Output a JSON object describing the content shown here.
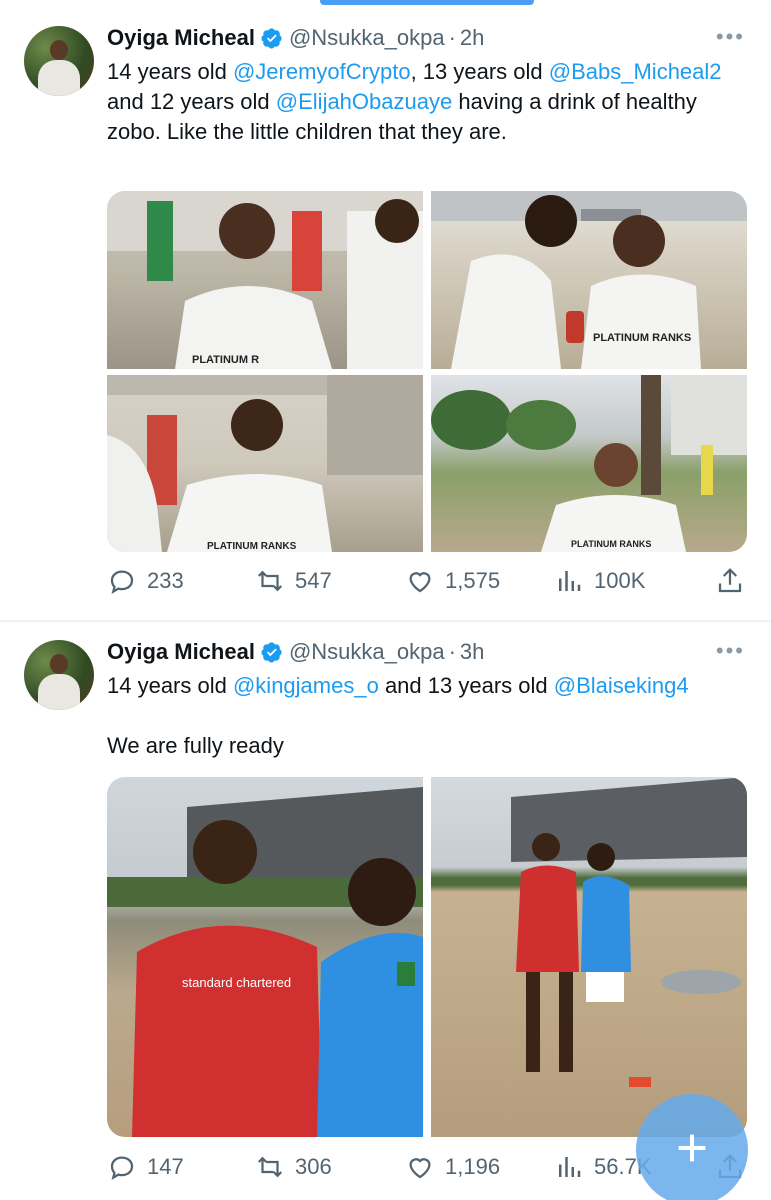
{
  "tweets": [
    {
      "author": "Oyiga Micheal",
      "handle": "@Nsukka_okpa",
      "sep": "·",
      "time": "2h",
      "text_parts": [
        "14 years old ",
        "@JeremyofCrypto",
        ", 13 years old ",
        "@Babs_Micheal2",
        " and 12 years old ",
        "@ElijahObazuaye",
        " having a drink of healthy zobo. Like the little children that they are."
      ],
      "photo_jersey_text": [
        "PLATINUM R",
        "PLATINUM RANKS",
        "PLATINUM RANKS",
        "PLATINUM RANKS"
      ],
      "stats": {
        "replies": "233",
        "retweets": "547",
        "likes": "1,575",
        "views": "100K"
      }
    },
    {
      "author": "Oyiga Micheal",
      "handle": "@Nsukka_okpa",
      "sep": "·",
      "time": "3h",
      "text_parts": [
        "14 years old ",
        "@kingjames_o",
        " and 13 years old ",
        "@Blaiseking4"
      ],
      "text_line2": "We are fully ready",
      "photo_jersey_text": [
        "standard chartered"
      ],
      "stats": {
        "replies": "147",
        "retweets": "306",
        "likes": "1,196",
        "views": "56.7K"
      }
    }
  ],
  "icons": {
    "more": "more-horizontal-icon",
    "verified": "verified-badge-icon",
    "reply": "reply-icon",
    "retweet": "retweet-icon",
    "like": "heart-icon",
    "views": "views-icon",
    "share": "share-icon",
    "compose": "plus-icon"
  },
  "colors": {
    "accent": "#1d9bf0",
    "secondary_text": "#536471",
    "fab": "#64aaeb"
  }
}
